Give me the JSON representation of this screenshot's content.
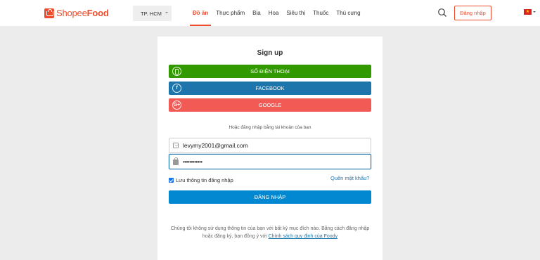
{
  "header": {
    "logo": {
      "part1": "Shopee",
      "part2": "Food"
    },
    "city": "TP. HCM",
    "nav": [
      {
        "label": "Đồ ăn",
        "active": true
      },
      {
        "label": "Thực phẩm",
        "active": false
      },
      {
        "label": "Bia",
        "active": false
      },
      {
        "label": "Hoa",
        "active": false
      },
      {
        "label": "Siêu thị",
        "active": false
      },
      {
        "label": "Thuốc",
        "active": false
      },
      {
        "label": "Thú cưng",
        "active": false
      }
    ],
    "login_label": "Đăng nhập",
    "flag_star": "★"
  },
  "signup": {
    "title": "Sign up",
    "phone_label": "SỐ ĐIỆN THOẠI",
    "facebook_label": "FACEBOOK",
    "facebook_icon_glyph": "f",
    "google_label": "GOOGLE",
    "google_icon_glyph": "G+",
    "alt_text": "Hoặc đăng nhập bằng tài khoản của bạn",
    "email_value": "levymy2001@gmail.com",
    "password_value": "••••••••••••",
    "remember_label": "Lưu thông tin đăng nhập",
    "remember_checked": true,
    "forgot_label": "Quên mật khẩu?",
    "submit_label": "ĐĂNG NHẬP",
    "terms_text": "Chúng tôi không sử dụng thông tin của bạn với bất kỳ mục đích nào. Bằng cách đăng nhập hoặc đăng ký, bạn đồng ý với",
    "terms_link": "Chính sách quy định của Foody"
  },
  "colors": {
    "brand": "#ee4d2d",
    "phone": "#339900",
    "facebook": "#1d75ac",
    "google": "#f25a56",
    "submit": "#0288d1"
  }
}
